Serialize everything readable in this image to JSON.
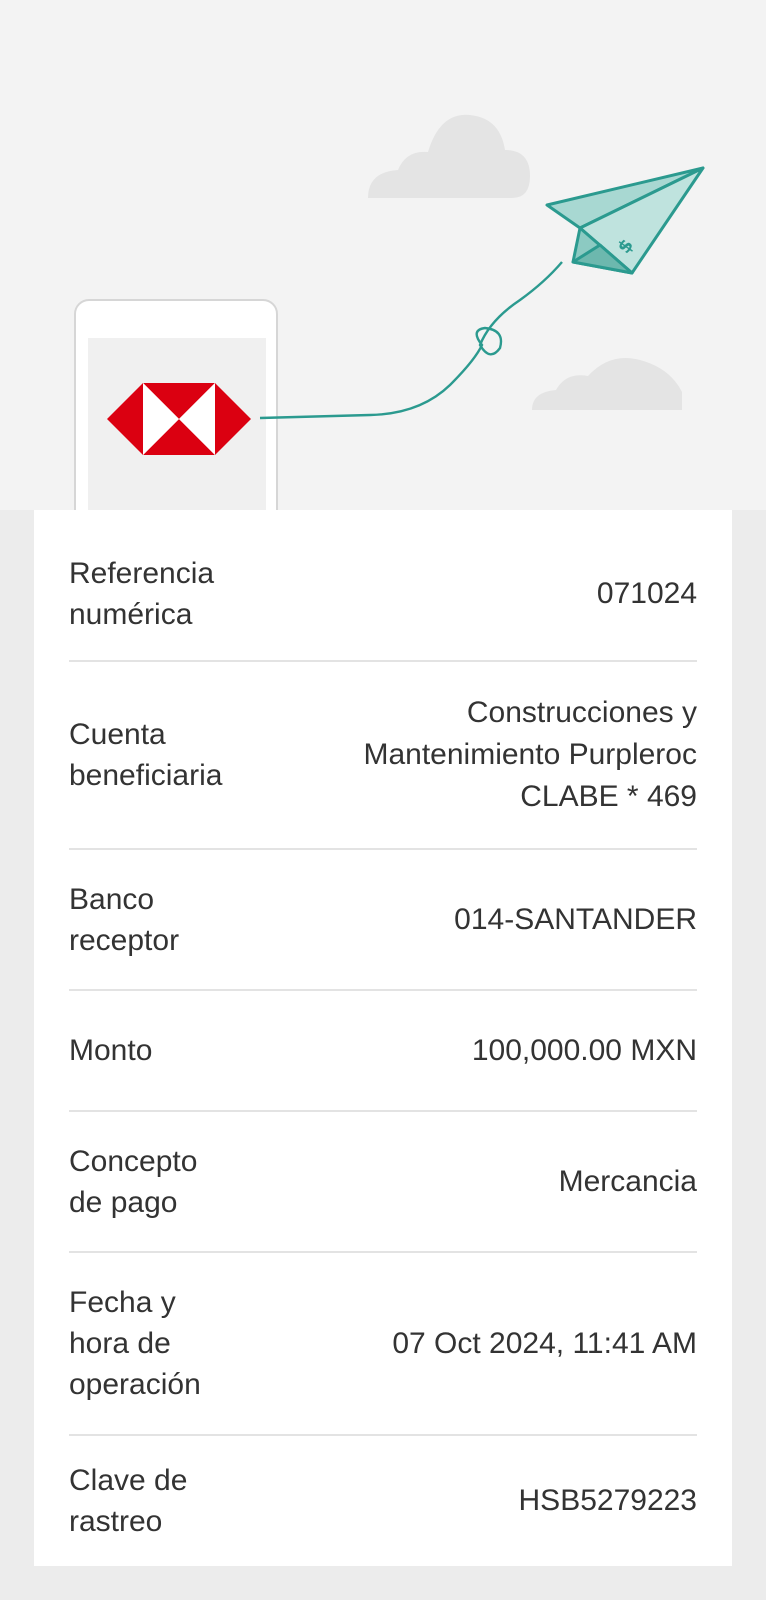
{
  "hero": {
    "logo": "hsbc-hexagon-logo",
    "illustration": "paper-plane-icon",
    "colors": {
      "logo_red": "#db0011",
      "plane_teal": "#2b9a8f",
      "plane_fill": "#a8d8d2",
      "cloud": "#e4e4e4"
    }
  },
  "details": {
    "rows": [
      {
        "label": "Referencia\nnumérica",
        "value": "071024"
      },
      {
        "label": "Cuenta\nbeneficiaria",
        "value": "Construcciones y\nMantenimiento Purpleroc\nCLABE * 469"
      },
      {
        "label": "Banco\nreceptor",
        "value": "014-SANTANDER"
      },
      {
        "label": "Monto",
        "value": "100,000.00 MXN"
      },
      {
        "label": "Concepto\nde pago",
        "value": "Mercancia"
      },
      {
        "label": "Fecha y\nhora de\noperación",
        "value": "07 Oct 2024, 11:41 AM"
      },
      {
        "label": "Clave de\nrastreo",
        "value": "HSB5279223"
      }
    ]
  }
}
